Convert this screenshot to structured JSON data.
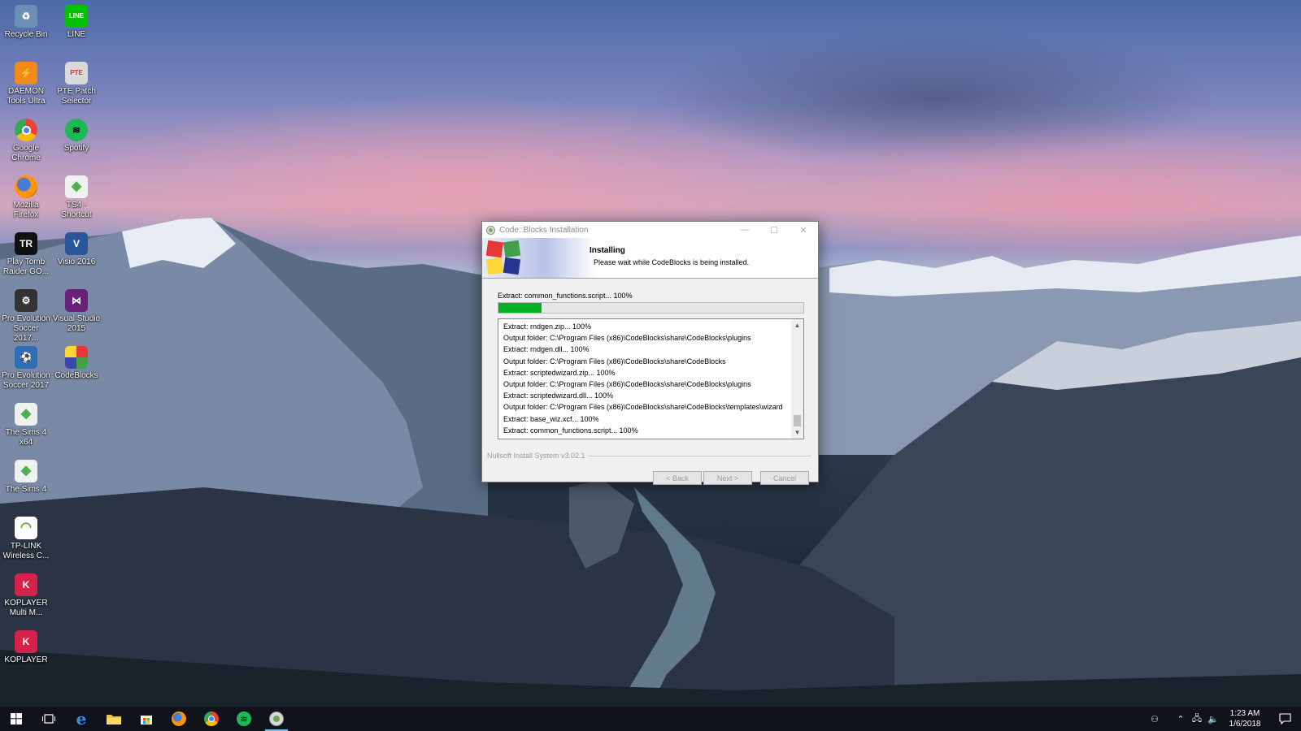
{
  "desktop": {
    "icons": [
      {
        "label": "Recycle Bin",
        "icon": "recycle-bin-icon",
        "color": "#6c8fb5",
        "glyph": "♻"
      },
      {
        "label": "LINE",
        "icon": "line-icon",
        "color": "#00c300",
        "glyph": "LINE"
      },
      {
        "label": "DAEMON Tools Ultra",
        "icon": "daemon-tools-icon",
        "color": "#f28a1b",
        "glyph": "⚡"
      },
      {
        "label": "PTE Patch Selector",
        "icon": "pte-patch-icon",
        "color": "#d9d9d9",
        "glyph": "PTE"
      },
      {
        "label": "Google Chrome",
        "icon": "chrome-icon",
        "color": "#4285f4",
        "glyph": "●"
      },
      {
        "label": "Spotify",
        "icon": "spotify-icon",
        "color": "#1db954",
        "glyph": "≋"
      },
      {
        "label": "Mozilla Firefox",
        "icon": "firefox-icon",
        "color": "#e66000",
        "glyph": "●"
      },
      {
        "label": "TS4 - Shortcut",
        "icon": "sims-icon",
        "color": "#4caf50",
        "glyph": "◆"
      },
      {
        "label": "Play Tomb Raider GO...",
        "icon": "tomb-raider-icon",
        "color": "#111111",
        "glyph": "TR"
      },
      {
        "label": "Visio 2016",
        "icon": "visio-icon",
        "color": "#2b579a",
        "glyph": "V"
      },
      {
        "label": "Pro Evolution Soccer 2017...",
        "icon": "pes-icon",
        "color": "#333333",
        "glyph": "⚙"
      },
      {
        "label": "Visual Studio 2015",
        "icon": "visual-studio-icon",
        "color": "#68217a",
        "glyph": "⋈"
      },
      {
        "label": "Pro Evolution Soccer 2017",
        "icon": "pes-game-icon",
        "color": "#2c6fb7",
        "glyph": "⚽"
      },
      {
        "label": "CodeBlocks",
        "icon": "codeblocks-icon",
        "color": "#3a3a9a",
        "glyph": "▦"
      },
      {
        "label": "The Sims 4 x64",
        "icon": "sims-x64-icon",
        "color": "#4caf50",
        "glyph": "◆"
      },
      {
        "label": "The Sims 4",
        "icon": "sims-4-icon",
        "color": "#4caf50",
        "glyph": "◆"
      },
      {
        "label": "TP-LINK Wireless C...",
        "icon": "tp-link-icon",
        "color": "#5aa02c",
        "glyph": "◠"
      },
      {
        "label": "KOPLAYER Multi M...",
        "icon": "koplayer-multi-icon",
        "color": "#d6224a",
        "glyph": "K"
      },
      {
        "label": "KOPLAYER",
        "icon": "koplayer-icon",
        "color": "#d6224a",
        "glyph": "K"
      }
    ]
  },
  "installer": {
    "window_title": "Code::Blocks Installation",
    "header_title": "Installing",
    "header_subtitle": "Please wait while CodeBlocks is being installed.",
    "status_text": "Extract: common_functions.script... 100%",
    "progress": 0.14,
    "log_lines": [
      "Extract: rndgen.zip... 100%",
      "Output folder: C:\\Program Files (x86)\\CodeBlocks\\share\\CodeBlocks\\plugins",
      "Extract: rndgen.dll... 100%",
      "Output folder: C:\\Program Files (x86)\\CodeBlocks\\share\\CodeBlocks",
      "Extract: scriptedwizard.zip... 100%",
      "Output folder: C:\\Program Files (x86)\\CodeBlocks\\share\\CodeBlocks\\plugins",
      "Extract: scriptedwizard.dll... 100%",
      "Output folder: C:\\Program Files (x86)\\CodeBlocks\\share\\CodeBlocks\\templates\\wizard",
      "Extract: base_wiz.xcf... 100%",
      "Extract: common_functions.script... 100%"
    ],
    "branding": "Nullsoft Install System v3.02.1",
    "back_label": "< Back",
    "next_label": "Next >",
    "cancel_label": "Cancel"
  },
  "taskbar": {
    "time": "1:23 AM",
    "date": "1/6/2018",
    "accent_color": "#76b9ed"
  }
}
